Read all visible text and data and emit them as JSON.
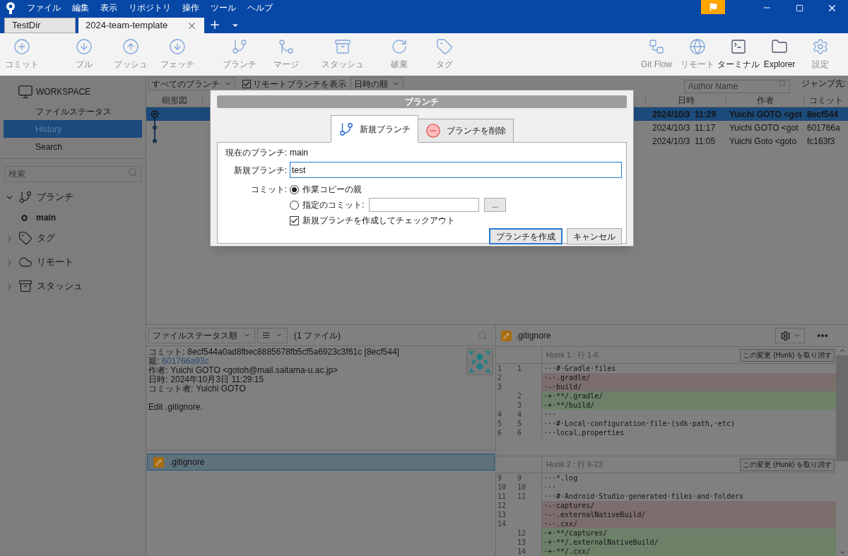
{
  "menu": [
    "ファイル",
    "編集",
    "表示",
    "リポジトリ",
    "操作",
    "ツール",
    "ヘルプ"
  ],
  "tabs": [
    {
      "label": "TestDir",
      "selected": false
    },
    {
      "label": "2024-team-template",
      "selected": true
    }
  ],
  "toolbar": {
    "left": [
      {
        "label": "コミット",
        "disabled": true
      },
      {
        "label": "プル",
        "disabled": true
      },
      {
        "label": "プッシュ",
        "disabled": true
      },
      {
        "label": "フェッチ",
        "disabled": true
      },
      {
        "label": "ブランチ",
        "disabled": true
      },
      {
        "label": "マージ",
        "disabled": true
      },
      {
        "label": "スタッシュ",
        "disabled": true
      },
      {
        "label": "破棄",
        "disabled": true
      },
      {
        "label": "タグ",
        "disabled": true
      }
    ],
    "right": [
      {
        "label": "Git Flow",
        "disabled": true
      },
      {
        "label": "リモート",
        "disabled": true
      },
      {
        "label": "ターミナル",
        "disabled": false
      },
      {
        "label": "Explorer",
        "disabled": false
      },
      {
        "label": "設定",
        "disabled": true
      }
    ]
  },
  "sidebar": {
    "workspace": "WORKSPACE",
    "items": [
      {
        "label": "ファイルステータス",
        "selected": false
      },
      {
        "label": "History",
        "selected": true
      },
      {
        "label": "Search",
        "selected": false
      }
    ],
    "search": {
      "placeholder": "検索"
    },
    "groups": [
      {
        "label": "ブランチ",
        "expanded": true,
        "children": [
          {
            "label": "main"
          }
        ]
      },
      {
        "label": "タグ",
        "expanded": false
      },
      {
        "label": "リモート",
        "expanded": false
      },
      {
        "label": "スタッシュ",
        "expanded": false
      }
    ]
  },
  "history": {
    "branch_filter": "すべてのブランチ",
    "show_remote": {
      "label": "リモートブランチを表示",
      "checked": true
    },
    "order": "日時の順",
    "author_search": {
      "placeholder": "Author Name"
    },
    "jump": "ジャンプ先:",
    "columns": {
      "graph": "樹形図",
      "date": "日時",
      "author": "作者",
      "commit": "コミット"
    },
    "rows": [
      {
        "date": "2024/10/3  11:29",
        "author": "Yuichi GOTO <got",
        "commit": "8ecf544",
        "selected": true
      },
      {
        "date": "2024/10/3  11:17",
        "author": "Yuichi GOTO <got",
        "commit": "601766a",
        "selected": false
      },
      {
        "date": "2024/10/3  11:05",
        "author": "Yuichi Goto <goto",
        "commit": "fc163f3",
        "selected": false
      }
    ]
  },
  "details": {
    "sort": "ファイルステータス順",
    "count": "(1 ファイル)",
    "lines": [
      {
        "label": "コミット:",
        "value": "8ecf544a0ad8fbec8885678fb5cf5a6923c3f61c [8ecf544]",
        "kind": "text"
      },
      {
        "label": "親:",
        "value": "601766a93c",
        "kind": "link"
      },
      {
        "label": "作者:",
        "value": "Yuichi GOTO <gotoh@mail.saitama-u.ac.jp>",
        "kind": "text"
      },
      {
        "label": "日時:",
        "value": "2024年10月3日 11:29:15",
        "kind": "text"
      },
      {
        "label": "コミット者:",
        "value": "Yuichi GOTO",
        "kind": "text"
      }
    ],
    "message": "Edit .gitignore.",
    "files": [
      {
        "name": ".gitignore",
        "selected": true
      }
    ]
  },
  "diff": {
    "file": ".gitignore",
    "hunks": [
      {
        "title": "Hunk 1 : 行 1-6",
        "button": "この変更 (Hunk) を取り消す",
        "lines": [
          {
            "old": "1",
            "new": "1",
            "kind": "context",
            "text": "···#·Gradle·files"
          },
          {
            "old": "2",
            "kind": "removed",
            "text": "·-·.gradle/"
          },
          {
            "old": "3",
            "kind": "removed",
            "text": "·-·build/"
          },
          {
            "new": "2",
            "kind": "added",
            "text": "·+·**/.gradle/"
          },
          {
            "new": "3",
            "kind": "added",
            "text": "·+·**/build/"
          },
          {
            "old": "4",
            "new": "4",
            "kind": "context",
            "text": "···"
          },
          {
            "old": "5",
            "new": "5",
            "kind": "context",
            "text": "···#·Local·configuration·file·(sdk·path,·etc)"
          },
          {
            "old": "6",
            "new": "6",
            "kind": "context",
            "text": "···local.properties"
          }
        ]
      },
      {
        "title": "Hunk 2 : 行 9-23",
        "button": "この変更 (Hunk) を取り消す",
        "lines": [
          {
            "old": "9",
            "new": "9",
            "kind": "context",
            "text": "···*.log"
          },
          {
            "old": "10",
            "new": "10",
            "kind": "context",
            "text": "···"
          },
          {
            "old": "11",
            "new": "11",
            "kind": "context",
            "text": "···#·Android·Studio·generated·files·and·folders"
          },
          {
            "old": "12",
            "kind": "removed",
            "text": "·-·captures/"
          },
          {
            "old": "13",
            "kind": "removed",
            "text": "·-·.externalNativeBuild/"
          },
          {
            "old": "14",
            "kind": "removed",
            "text": "·-·.cxx/"
          },
          {
            "new": "12",
            "kind": "added",
            "text": "·+·**/captures/"
          },
          {
            "new": "13",
            "kind": "added",
            "text": "·+·**/.externalNativeBuild/"
          },
          {
            "new": "14",
            "kind": "added",
            "text": "·+·**/.cxx/"
          }
        ]
      }
    ]
  },
  "dialog": {
    "title": "ブランチ",
    "tabs": [
      {
        "label": "新規ブランチ",
        "selected": true
      },
      {
        "label": "ブランチを削除",
        "selected": false
      }
    ],
    "current_branch": {
      "label": "現在のブランチ:",
      "value": "main"
    },
    "new_branch": {
      "label": "新規ブランチ:",
      "value": "test"
    },
    "commit": {
      "label": "コミット:",
      "options": [
        {
          "label": "作業コピーの親",
          "selected": true
        },
        {
          "label": "指定のコミット:",
          "selected": false
        }
      ],
      "browse": "..."
    },
    "checkout": {
      "label": "新規ブランチを作成してチェックアウト",
      "checked": true
    },
    "buttons": [
      {
        "label": "ブランチを作成",
        "kind": "primary"
      },
      {
        "label": "キャンセル",
        "kind": "secondary"
      }
    ]
  }
}
